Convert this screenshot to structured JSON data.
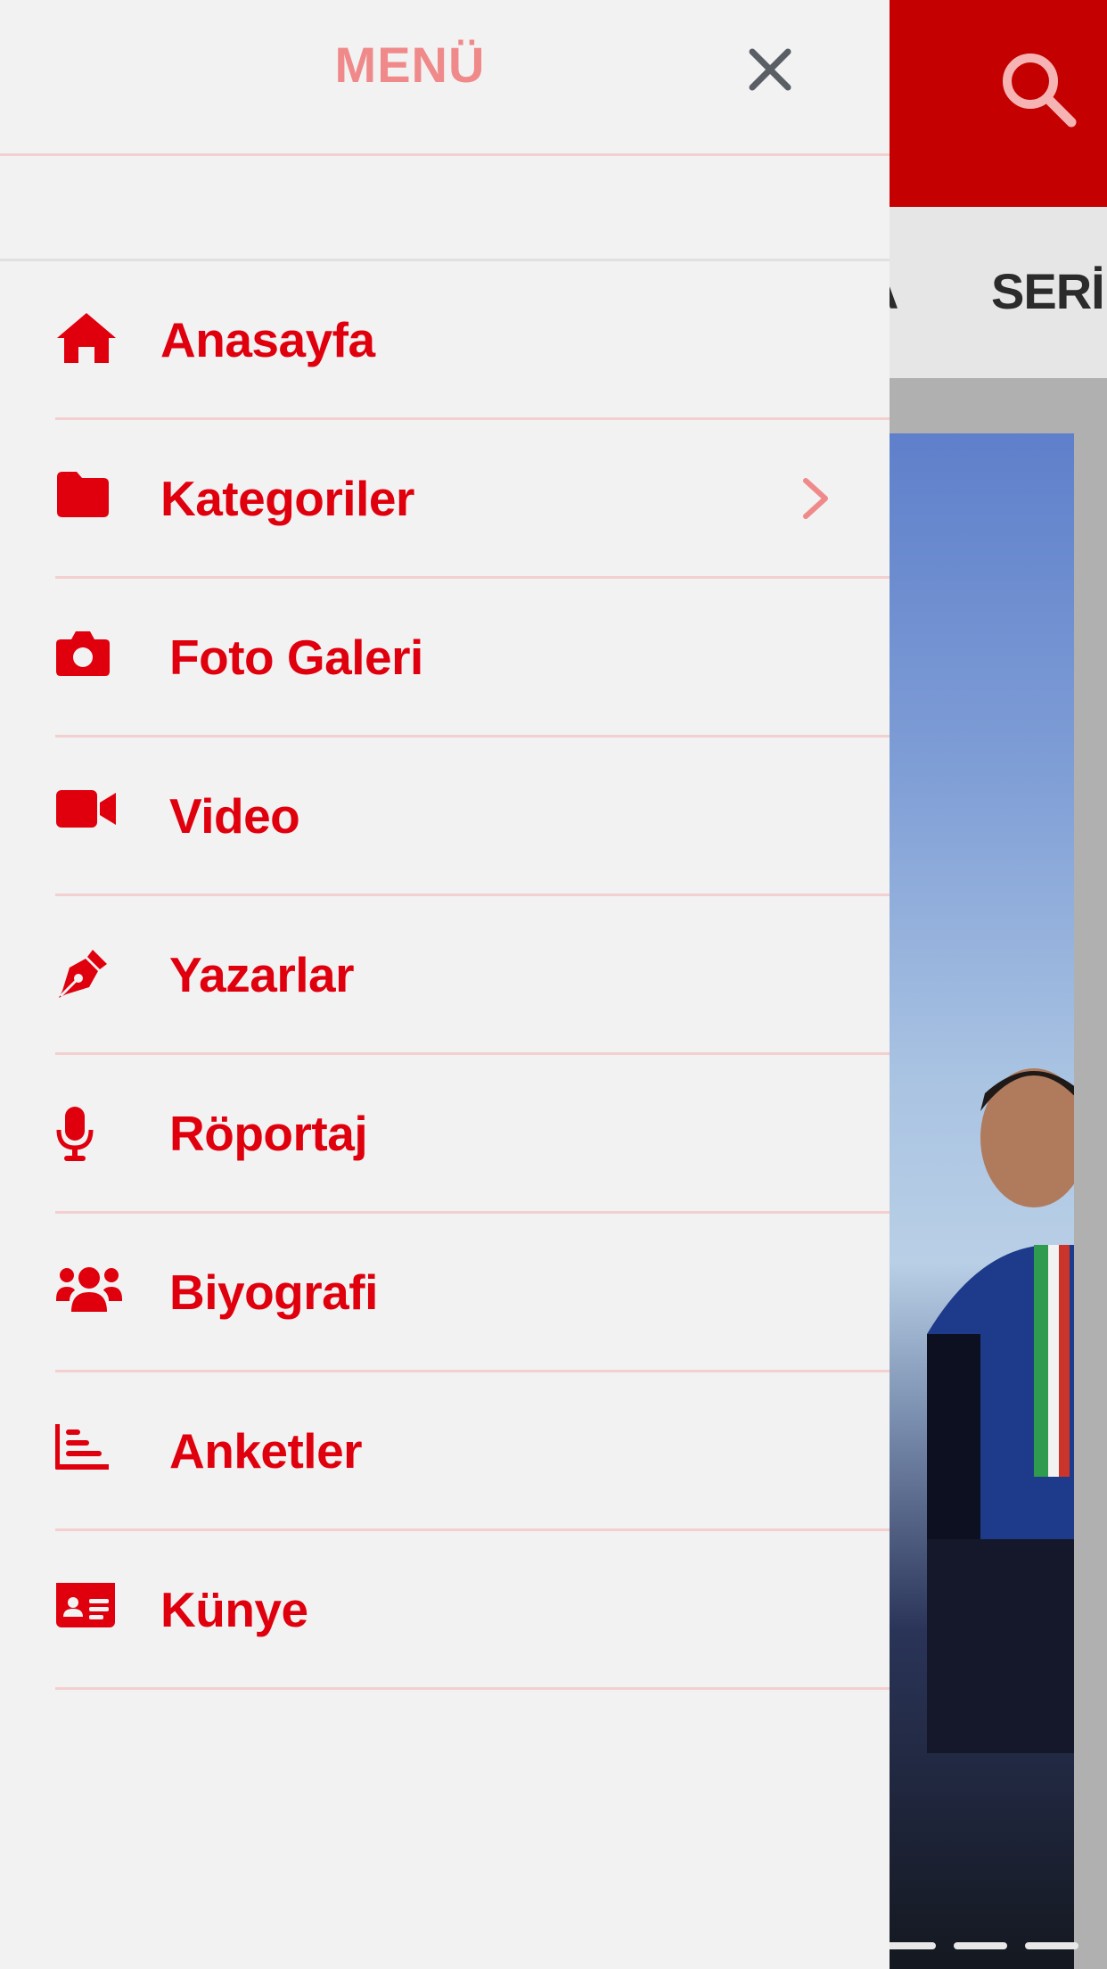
{
  "colors": {
    "brand_red": "#e0000d",
    "header_red": "#c40000",
    "divider_pink": "#f3cfcf",
    "title_pink": "#f08a8a",
    "drawer_bg": "#f2f2f3"
  },
  "background": {
    "tabs": [
      "A",
      "SERİ"
    ],
    "search_icon": "search-icon"
  },
  "drawer": {
    "title": "MENÜ",
    "close_icon": "close-icon",
    "items": [
      {
        "label": "Anasayfa",
        "icon": "home-icon"
      },
      {
        "label": "Kategoriler",
        "icon": "folder-icon",
        "has_submenu": true
      },
      {
        "label": "Foto Galeri",
        "icon": "camera-icon"
      },
      {
        "label": "Video",
        "icon": "video-icon"
      },
      {
        "label": "Yazarlar",
        "icon": "pen-icon"
      },
      {
        "label": "Röportaj",
        "icon": "microphone-icon"
      },
      {
        "label": "Biyografi",
        "icon": "users-icon"
      },
      {
        "label": "Anketler",
        "icon": "chart-icon"
      },
      {
        "label": "Künye",
        "icon": "id-card-icon"
      }
    ]
  }
}
